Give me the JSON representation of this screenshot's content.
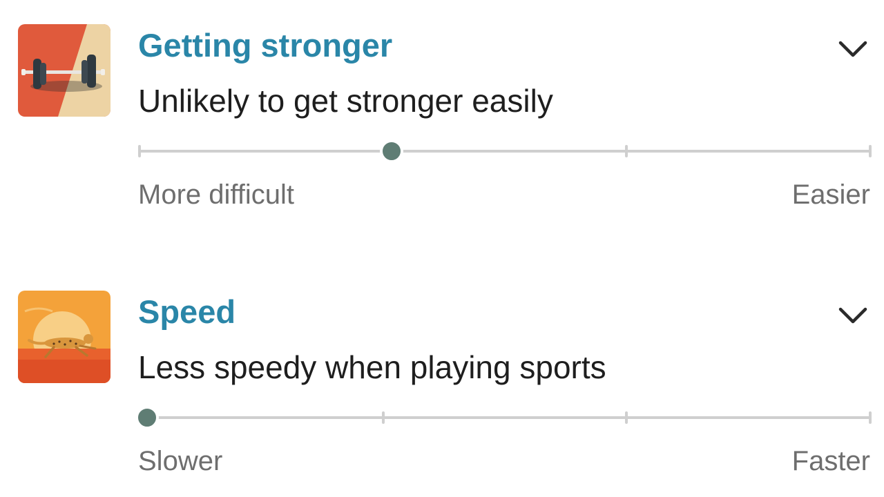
{
  "traits": [
    {
      "title": "Getting stronger",
      "summary": "Unlikely to get stronger easily",
      "icon": "barbell-icon",
      "scale": {
        "left_label": "More difficult",
        "right_label": "Easier",
        "steps": 4,
        "value_fraction": 0.345
      }
    },
    {
      "title": "Speed",
      "summary": "Less speedy when playing sports",
      "icon": "cheetah-icon",
      "scale": {
        "left_label": "Slower",
        "right_label": "Faster",
        "steps": 4,
        "value_fraction": 0.01
      }
    }
  ],
  "colors": {
    "title": "#2a86a8",
    "knob": "#5f7d74",
    "track": "#cfcfcf"
  }
}
